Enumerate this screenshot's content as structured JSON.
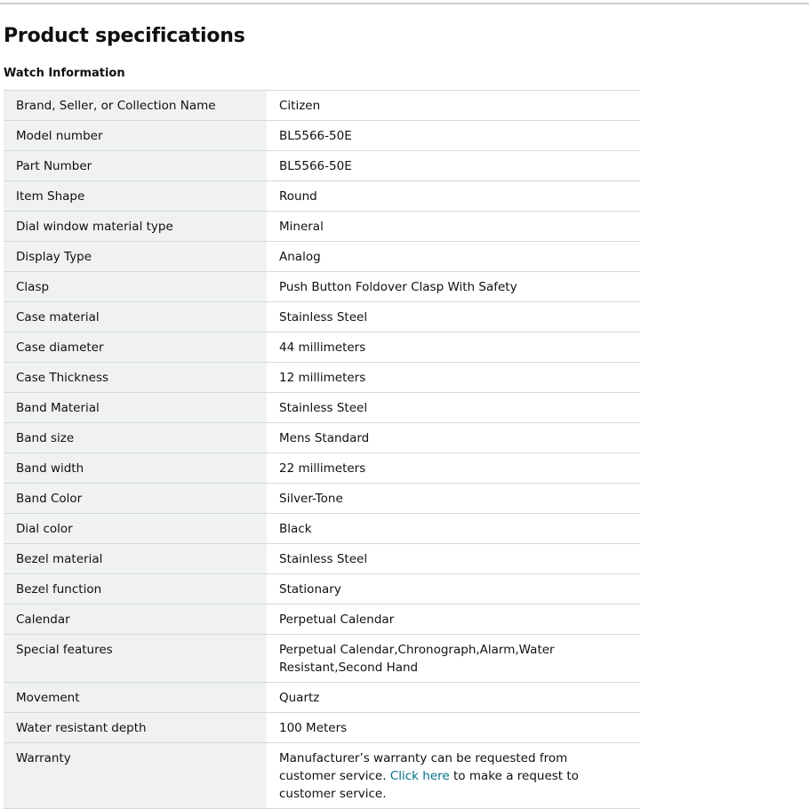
{
  "page": {
    "title": "Product specifications"
  },
  "section": {
    "title": "Watch Information"
  },
  "specs": [
    {
      "label": "Brand, Seller, or Collection Name",
      "value": "Citizen"
    },
    {
      "label": "Model number",
      "value": "BL5566-50E"
    },
    {
      "label": "Part Number",
      "value": "BL5566-50E"
    },
    {
      "label": "Item Shape",
      "value": "Round"
    },
    {
      "label": "Dial window material type",
      "value": "Mineral"
    },
    {
      "label": "Display Type",
      "value": "Analog"
    },
    {
      "label": "Clasp",
      "value": "Push Button Foldover Clasp With Safety"
    },
    {
      "label": "Case material",
      "value": "Stainless Steel"
    },
    {
      "label": "Case diameter",
      "value": "44 millimeters"
    },
    {
      "label": "Case Thickness",
      "value": "12 millimeters"
    },
    {
      "label": "Band Material",
      "value": "Stainless Steel"
    },
    {
      "label": "Band size",
      "value": "Mens Standard"
    },
    {
      "label": "Band width",
      "value": "22 millimeters"
    },
    {
      "label": "Band Color",
      "value": "Silver-Tone"
    },
    {
      "label": "Dial color",
      "value": "Black"
    },
    {
      "label": "Bezel material",
      "value": "Stainless Steel"
    },
    {
      "label": "Bezel function",
      "value": "Stationary"
    },
    {
      "label": "Calendar",
      "value": "Perpetual Calendar"
    },
    {
      "label": "Special features",
      "value": "Perpetual Calendar,Chronograph,Alarm,Water Resistant,Second Hand"
    },
    {
      "label": "Movement",
      "value": "Quartz"
    },
    {
      "label": "Water resistant depth",
      "value": "100 Meters"
    }
  ],
  "warranty": {
    "label": "Warranty",
    "text_before": "Manufacturer’s warranty can be requested from customer service. ",
    "link_text": "Click here",
    "text_after": " to make a request to customer service."
  },
  "colors": {
    "key_cell_background": "#f0f2f2",
    "row_border": "#d5d9d9",
    "link": "#007185",
    "text": "#0f1111"
  }
}
